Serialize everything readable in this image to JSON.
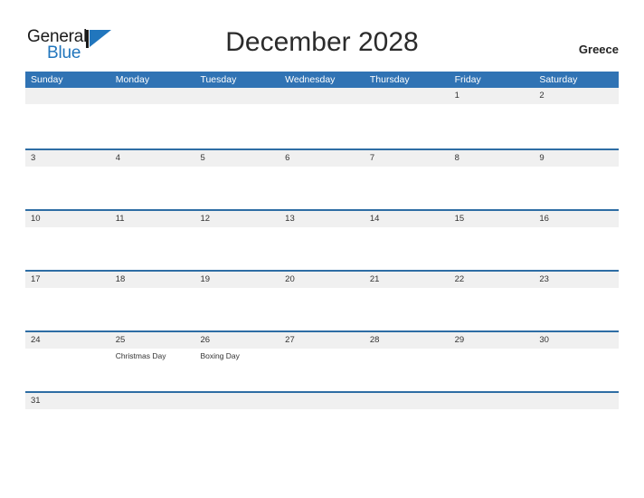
{
  "brand": {
    "name_part1": "General",
    "name_part2": "Blue",
    "flag_icon": "flag-icon",
    "accent_color": "#2176bd"
  },
  "header": {
    "title": "December 2028",
    "country": "Greece"
  },
  "theme": {
    "header_blue": "#3073b4",
    "divider_blue": "#2e6da4",
    "band_gray": "#f0f0f0",
    "text_dark": "#333333"
  },
  "calendar": {
    "month": "December",
    "year": "2028",
    "weekday_headers": [
      "Sunday",
      "Monday",
      "Tuesday",
      "Wednesday",
      "Thursday",
      "Friday",
      "Saturday"
    ],
    "weeks": [
      [
        {
          "day": "",
          "events": []
        },
        {
          "day": "",
          "events": []
        },
        {
          "day": "",
          "events": []
        },
        {
          "day": "",
          "events": []
        },
        {
          "day": "",
          "events": []
        },
        {
          "day": "1",
          "events": []
        },
        {
          "day": "2",
          "events": []
        }
      ],
      [
        {
          "day": "3",
          "events": []
        },
        {
          "day": "4",
          "events": []
        },
        {
          "day": "5",
          "events": []
        },
        {
          "day": "6",
          "events": []
        },
        {
          "day": "7",
          "events": []
        },
        {
          "day": "8",
          "events": []
        },
        {
          "day": "9",
          "events": []
        }
      ],
      [
        {
          "day": "10",
          "events": []
        },
        {
          "day": "11",
          "events": []
        },
        {
          "day": "12",
          "events": []
        },
        {
          "day": "13",
          "events": []
        },
        {
          "day": "14",
          "events": []
        },
        {
          "day": "15",
          "events": []
        },
        {
          "day": "16",
          "events": []
        }
      ],
      [
        {
          "day": "17",
          "events": []
        },
        {
          "day": "18",
          "events": []
        },
        {
          "day": "19",
          "events": []
        },
        {
          "day": "20",
          "events": []
        },
        {
          "day": "21",
          "events": []
        },
        {
          "day": "22",
          "events": []
        },
        {
          "day": "23",
          "events": []
        }
      ],
      [
        {
          "day": "24",
          "events": []
        },
        {
          "day": "25",
          "events": [
            "Christmas Day"
          ]
        },
        {
          "day": "26",
          "events": [
            "Boxing Day"
          ]
        },
        {
          "day": "27",
          "events": []
        },
        {
          "day": "28",
          "events": []
        },
        {
          "day": "29",
          "events": []
        },
        {
          "day": "30",
          "events": []
        }
      ],
      [
        {
          "day": "31",
          "events": []
        },
        {
          "day": "",
          "events": []
        },
        {
          "day": "",
          "events": []
        },
        {
          "day": "",
          "events": []
        },
        {
          "day": "",
          "events": []
        },
        {
          "day": "",
          "events": []
        },
        {
          "day": "",
          "events": []
        }
      ]
    ]
  }
}
